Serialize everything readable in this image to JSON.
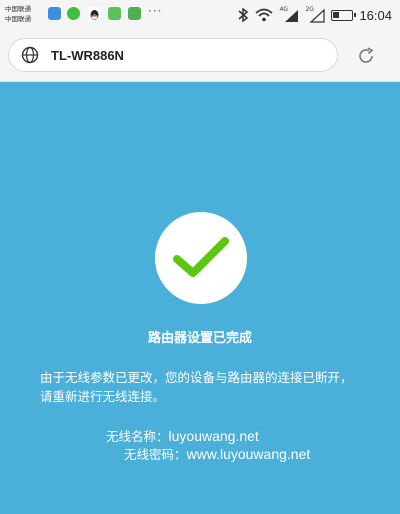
{
  "statusbar": {
    "carrier_line1": "中国联通",
    "carrier_line2": "中国联通",
    "app_icons": [
      {
        "name": "browser-app-icon",
        "color": "#3d8fe0"
      },
      {
        "name": "wechat-app-icon",
        "color": "#3fbf3f"
      },
      {
        "name": "qq-app-icon",
        "color": "#222222"
      },
      {
        "name": "message-app-icon",
        "color": "#5cc15c"
      },
      {
        "name": "photo-app-icon",
        "color": "#4caf50"
      }
    ],
    "more": "···",
    "signal1_label": "4G",
    "signal2_label": "2G",
    "time": "16:04"
  },
  "browser": {
    "url": "TL-WR886N"
  },
  "main": {
    "title": "路由器设置已完成",
    "message": "由于无线参数已更改，您的设备与路由器的连接已断开，请重新进行无线连接。",
    "ssid_label": "无线名称：",
    "ssid_value": "luyouwang.net",
    "password_label": "无线密码：",
    "password_value": "www.luyouwang.net",
    "accent_check_color": "#5cc614",
    "background_color": "#4aafd9"
  }
}
